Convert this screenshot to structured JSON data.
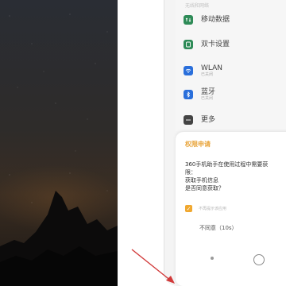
{
  "settings": {
    "header": "无线和网络",
    "items": [
      {
        "label": "移动数据",
        "sub": "",
        "icon": "mobile-data-icon",
        "color": "#2e8b57"
      },
      {
        "label": "双卡设置",
        "sub": "",
        "icon": "dual-sim-icon",
        "color": "#2e8b57"
      },
      {
        "label": "WLAN",
        "sub": "已关闭",
        "icon": "wifi-icon",
        "color": "#2a6fdb"
      },
      {
        "label": "蓝牙",
        "sub": "已关闭",
        "icon": "bluetooth-icon",
        "color": "#2a6fdb"
      },
      {
        "label": "更多",
        "sub": "",
        "icon": "more-icon",
        "color": "#444444"
      }
    ]
  },
  "dialog": {
    "title": "权限申请",
    "body_line1": "360手机助手在使用过程中需要获",
    "body_line2": "限：",
    "body_line3": "获取手机信息",
    "body_line4": "是否同意获取？",
    "remember_label": "不再提示该应用",
    "deny_label": "不同意（10s）"
  },
  "colors": {
    "accent": "#e8a43a",
    "arrow": "#d23a3a"
  }
}
